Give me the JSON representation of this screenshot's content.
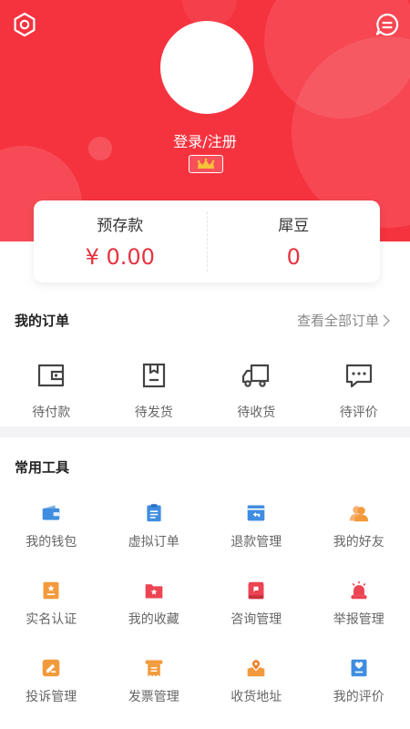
{
  "user": {
    "login_label": "登录/注册"
  },
  "balance": [
    {
      "label": "预存款",
      "value": "¥ 0.00"
    },
    {
      "label": "犀豆",
      "value": "0"
    }
  ],
  "orders": {
    "title": "我的订单",
    "view_all": "查看全部订单",
    "items": [
      {
        "label": "待付款",
        "icon": "wallet-icon"
      },
      {
        "label": "待发货",
        "icon": "package-icon"
      },
      {
        "label": "待收货",
        "icon": "truck-icon"
      },
      {
        "label": "待评价",
        "icon": "comment-icon"
      }
    ]
  },
  "tools": {
    "title": "常用工具",
    "items": [
      {
        "label": "我的钱包",
        "icon": "wallet-icon",
        "color": "#3f8de0"
      },
      {
        "label": "虚拟订单",
        "icon": "clipboard-icon",
        "color": "#3f8de0"
      },
      {
        "label": "退款管理",
        "icon": "refund-icon",
        "color": "#3f8de0"
      },
      {
        "label": "我的好友",
        "icon": "friends-icon",
        "color": "#f39a3c"
      },
      {
        "label": "实名认证",
        "icon": "id-card-icon",
        "color": "#f39a3c"
      },
      {
        "label": "我的收藏",
        "icon": "favorite-folder-icon",
        "color": "#ec4453"
      },
      {
        "label": "咨询管理",
        "icon": "consult-icon",
        "color": "#ec4453"
      },
      {
        "label": "举报管理",
        "icon": "alarm-icon",
        "color": "#ec4453"
      },
      {
        "label": "投诉管理",
        "icon": "complaint-icon",
        "color": "#f39a3c"
      },
      {
        "label": "发票管理",
        "icon": "invoice-icon",
        "color": "#f39a3c"
      },
      {
        "label": "收货地址",
        "icon": "location-icon",
        "color": "#f39a3c"
      },
      {
        "label": "我的评价",
        "icon": "rating-icon",
        "color": "#3f8de0"
      }
    ]
  },
  "colors": {
    "brand_red": "#f5333f",
    "price_red": "#e53340",
    "tool_blue": "#3f8de0",
    "tool_orange": "#f39a3c",
    "tool_red": "#ec4453"
  }
}
